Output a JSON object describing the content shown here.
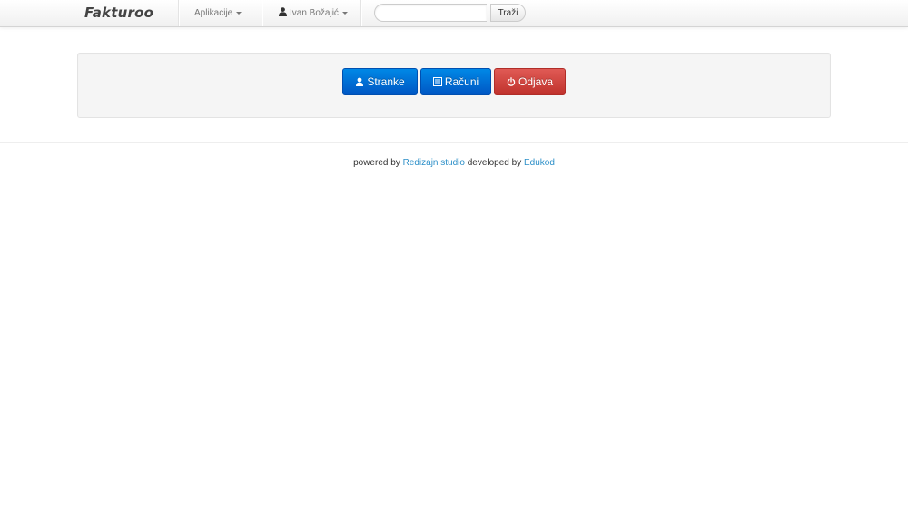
{
  "navbar": {
    "brand": "Fakturoo",
    "apps_label": "Aplikacije",
    "user_label": "Ivan Božajić",
    "search_placeholder": "",
    "search_button": "Traži"
  },
  "actions": [
    {
      "label": "Stranke",
      "icon": "user-icon",
      "color": "#0069d6"
    },
    {
      "label": "Računi",
      "icon": "list-icon",
      "color": "#0069d6"
    },
    {
      "label": "Odjava",
      "icon": "power-icon",
      "color": "#d9534f"
    }
  ],
  "footer": {
    "prefix": "powered by",
    "link1": "Redizajn studio",
    "middle": "developed by",
    "link2": "Edukod"
  },
  "colors": {
    "primary": "#0069d6",
    "danger": "#d9534f",
    "link": "#2c8fc8"
  }
}
